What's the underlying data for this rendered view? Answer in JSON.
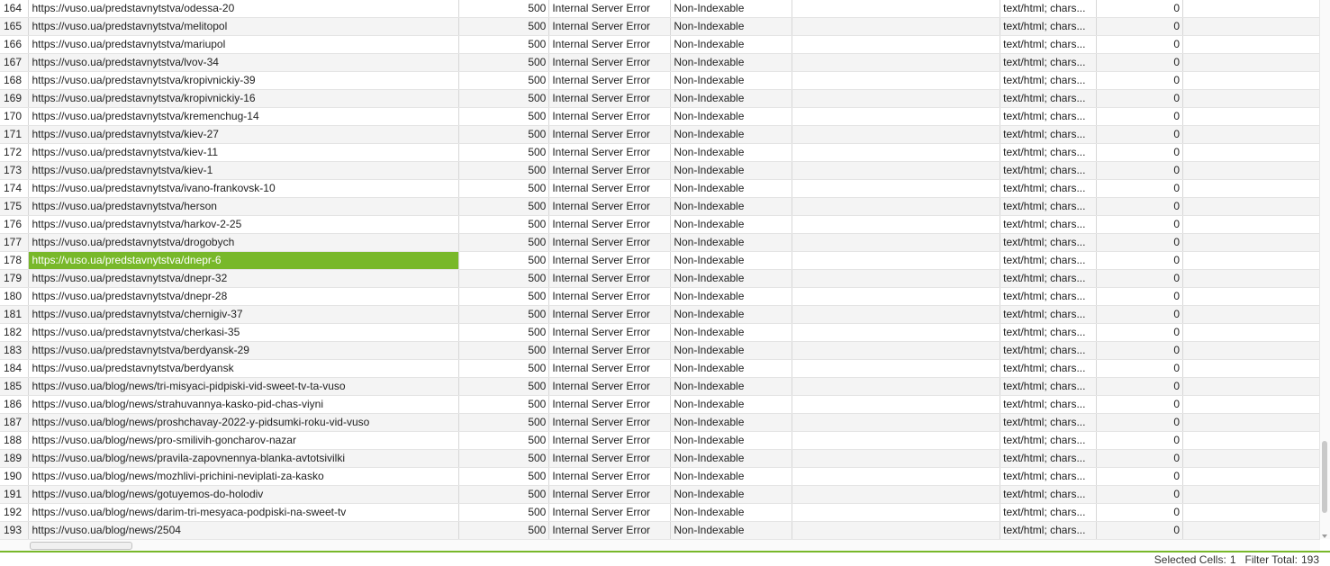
{
  "colors": {
    "selection": "#78b82a",
    "status_accent": "#78b82a"
  },
  "rows": [
    {
      "n": "164",
      "url": "https://vuso.ua/predstavnytstva/odessa-20",
      "code": "500",
      "status": "Internal Server Error",
      "idx": "Non-Indexable",
      "type": "text/html; chars...",
      "size": "0"
    },
    {
      "n": "165",
      "url": "https://vuso.ua/predstavnytstva/melitopol",
      "code": "500",
      "status": "Internal Server Error",
      "idx": "Non-Indexable",
      "type": "text/html; chars...",
      "size": "0"
    },
    {
      "n": "166",
      "url": "https://vuso.ua/predstavnytstva/mariupol",
      "code": "500",
      "status": "Internal Server Error",
      "idx": "Non-Indexable",
      "type": "text/html; chars...",
      "size": "0"
    },
    {
      "n": "167",
      "url": "https://vuso.ua/predstavnytstva/lvov-34",
      "code": "500",
      "status": "Internal Server Error",
      "idx": "Non-Indexable",
      "type": "text/html; chars...",
      "size": "0"
    },
    {
      "n": "168",
      "url": "https://vuso.ua/predstavnytstva/kropivnickiy-39",
      "code": "500",
      "status": "Internal Server Error",
      "idx": "Non-Indexable",
      "type": "text/html; chars...",
      "size": "0"
    },
    {
      "n": "169",
      "url": "https://vuso.ua/predstavnytstva/kropivnickiy-16",
      "code": "500",
      "status": "Internal Server Error",
      "idx": "Non-Indexable",
      "type": "text/html; chars...",
      "size": "0"
    },
    {
      "n": "170",
      "url": "https://vuso.ua/predstavnytstva/kremenchug-14",
      "code": "500",
      "status": "Internal Server Error",
      "idx": "Non-Indexable",
      "type": "text/html; chars...",
      "size": "0"
    },
    {
      "n": "171",
      "url": "https://vuso.ua/predstavnytstva/kiev-27",
      "code": "500",
      "status": "Internal Server Error",
      "idx": "Non-Indexable",
      "type": "text/html; chars...",
      "size": "0"
    },
    {
      "n": "172",
      "url": "https://vuso.ua/predstavnytstva/kiev-11",
      "code": "500",
      "status": "Internal Server Error",
      "idx": "Non-Indexable",
      "type": "text/html; chars...",
      "size": "0"
    },
    {
      "n": "173",
      "url": "https://vuso.ua/predstavnytstva/kiev-1",
      "code": "500",
      "status": "Internal Server Error",
      "idx": "Non-Indexable",
      "type": "text/html; chars...",
      "size": "0"
    },
    {
      "n": "174",
      "url": "https://vuso.ua/predstavnytstva/ivano-frankovsk-10",
      "code": "500",
      "status": "Internal Server Error",
      "idx": "Non-Indexable",
      "type": "text/html; chars...",
      "size": "0"
    },
    {
      "n": "175",
      "url": "https://vuso.ua/predstavnytstva/herson",
      "code": "500",
      "status": "Internal Server Error",
      "idx": "Non-Indexable",
      "type": "text/html; chars...",
      "size": "0"
    },
    {
      "n": "176",
      "url": "https://vuso.ua/predstavnytstva/harkov-2-25",
      "code": "500",
      "status": "Internal Server Error",
      "idx": "Non-Indexable",
      "type": "text/html; chars...",
      "size": "0"
    },
    {
      "n": "177",
      "url": "https://vuso.ua/predstavnytstva/drogobych",
      "code": "500",
      "status": "Internal Server Error",
      "idx": "Non-Indexable",
      "type": "text/html; chars...",
      "size": "0"
    },
    {
      "n": "178",
      "url": "https://vuso.ua/predstavnytstva/dnepr-6",
      "code": "500",
      "status": "Internal Server Error",
      "idx": "Non-Indexable",
      "type": "text/html; chars...",
      "size": "0",
      "selected": true
    },
    {
      "n": "179",
      "url": "https://vuso.ua/predstavnytstva/dnepr-32",
      "code": "500",
      "status": "Internal Server Error",
      "idx": "Non-Indexable",
      "type": "text/html; chars...",
      "size": "0"
    },
    {
      "n": "180",
      "url": "https://vuso.ua/predstavnytstva/dnepr-28",
      "code": "500",
      "status": "Internal Server Error",
      "idx": "Non-Indexable",
      "type": "text/html; chars...",
      "size": "0"
    },
    {
      "n": "181",
      "url": "https://vuso.ua/predstavnytstva/chernigiv-37",
      "code": "500",
      "status": "Internal Server Error",
      "idx": "Non-Indexable",
      "type": "text/html; chars...",
      "size": "0"
    },
    {
      "n": "182",
      "url": "https://vuso.ua/predstavnytstva/cherkasi-35",
      "code": "500",
      "status": "Internal Server Error",
      "idx": "Non-Indexable",
      "type": "text/html; chars...",
      "size": "0"
    },
    {
      "n": "183",
      "url": "https://vuso.ua/predstavnytstva/berdyansk-29",
      "code": "500",
      "status": "Internal Server Error",
      "idx": "Non-Indexable",
      "type": "text/html; chars...",
      "size": "0"
    },
    {
      "n": "184",
      "url": "https://vuso.ua/predstavnytstva/berdyansk",
      "code": "500",
      "status": "Internal Server Error",
      "idx": "Non-Indexable",
      "type": "text/html; chars...",
      "size": "0"
    },
    {
      "n": "185",
      "url": "https://vuso.ua/blog/news/tri-misyaci-pidpiski-vid-sweet-tv-ta-vuso",
      "code": "500",
      "status": "Internal Server Error",
      "idx": "Non-Indexable",
      "type": "text/html; chars...",
      "size": "0"
    },
    {
      "n": "186",
      "url": "https://vuso.ua/blog/news/strahuvannya-kasko-pid-chas-viyni",
      "code": "500",
      "status": "Internal Server Error",
      "idx": "Non-Indexable",
      "type": "text/html; chars...",
      "size": "0"
    },
    {
      "n": "187",
      "url": "https://vuso.ua/blog/news/proshchavay-2022-y-pidsumki-roku-vid-vuso",
      "code": "500",
      "status": "Internal Server Error",
      "idx": "Non-Indexable",
      "type": "text/html; chars...",
      "size": "0"
    },
    {
      "n": "188",
      "url": "https://vuso.ua/blog/news/pro-smilivih-goncharov-nazar",
      "code": "500",
      "status": "Internal Server Error",
      "idx": "Non-Indexable",
      "type": "text/html; chars...",
      "size": "0"
    },
    {
      "n": "189",
      "url": "https://vuso.ua/blog/news/pravila-zapovnennya-blanka-avtotsivilki",
      "code": "500",
      "status": "Internal Server Error",
      "idx": "Non-Indexable",
      "type": "text/html; chars...",
      "size": "0"
    },
    {
      "n": "190",
      "url": "https://vuso.ua/blog/news/mozhlivi-prichini-neviplati-za-kasko",
      "code": "500",
      "status": "Internal Server Error",
      "idx": "Non-Indexable",
      "type": "text/html; chars...",
      "size": "0"
    },
    {
      "n": "191",
      "url": "https://vuso.ua/blog/news/gotuyemos-do-holodiv",
      "code": "500",
      "status": "Internal Server Error",
      "idx": "Non-Indexable",
      "type": "text/html; chars...",
      "size": "0"
    },
    {
      "n": "192",
      "url": "https://vuso.ua/blog/news/darim-tri-mesyaca-podpiski-na-sweet-tv",
      "code": "500",
      "status": "Internal Server Error",
      "idx": "Non-Indexable",
      "type": "text/html; chars...",
      "size": "0"
    },
    {
      "n": "193",
      "url": "https://vuso.ua/blog/news/2504",
      "code": "500",
      "status": "Internal Server Error",
      "idx": "Non-Indexable",
      "type": "text/html; chars...",
      "size": "0"
    }
  ],
  "statusbar": {
    "selected_label": "Selected Cells:",
    "selected_value": "1",
    "filter_label": "Filter Total:",
    "filter_value": "193"
  },
  "scroll": {
    "vertical_position": 0.97
  }
}
